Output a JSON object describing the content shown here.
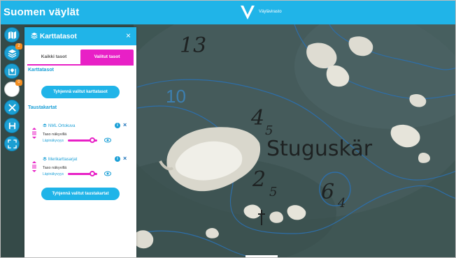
{
  "app": {
    "title": "Suomen väylät",
    "logo_text": "Väylävirasto"
  },
  "toolbar": {
    "items": [
      {
        "icon": "map-icon",
        "label": "Kartta"
      },
      {
        "icon": "layers-icon",
        "badge": "2"
      },
      {
        "icon": "map-pin-icon"
      },
      {
        "icon": "circle-icon",
        "badge": "0"
      },
      {
        "icon": "tools-icon"
      },
      {
        "icon": "save-icon"
      },
      {
        "icon": "fullscreen-icon"
      }
    ]
  },
  "panel": {
    "title": "Karttatasot",
    "close": "×",
    "tabs": [
      {
        "label": "Kaikki tasot",
        "active": false
      },
      {
        "label": "Valitut tasot",
        "active": true
      }
    ],
    "sections": {
      "map_layers_title": "Karttatasot",
      "clear_map_layers": "Tyhjennä valitut karttatasot",
      "background_title": "Taustakartat",
      "clear_background": "Tyhjennä valitut taustakartat"
    },
    "layers": [
      {
        "name": "NML Ortokuva",
        "visibility": "Taso näkyvillä",
        "opacity_label": "Läpinäkyvyys",
        "opacity": 0.9
      },
      {
        "name": "Merikarttasarjat",
        "visibility": "Taso näkyvillä",
        "opacity_label": "Läpinäkyvyys",
        "opacity": 0.9
      }
    ]
  },
  "map": {
    "labels": [
      "13",
      "10",
      "4",
      "5",
      "Stuguskär",
      "2",
      "5",
      "6",
      "4"
    ]
  },
  "colors": {
    "brand": "#20b4e8",
    "accent": "#e820c6",
    "badge": "#f28c1e"
  }
}
